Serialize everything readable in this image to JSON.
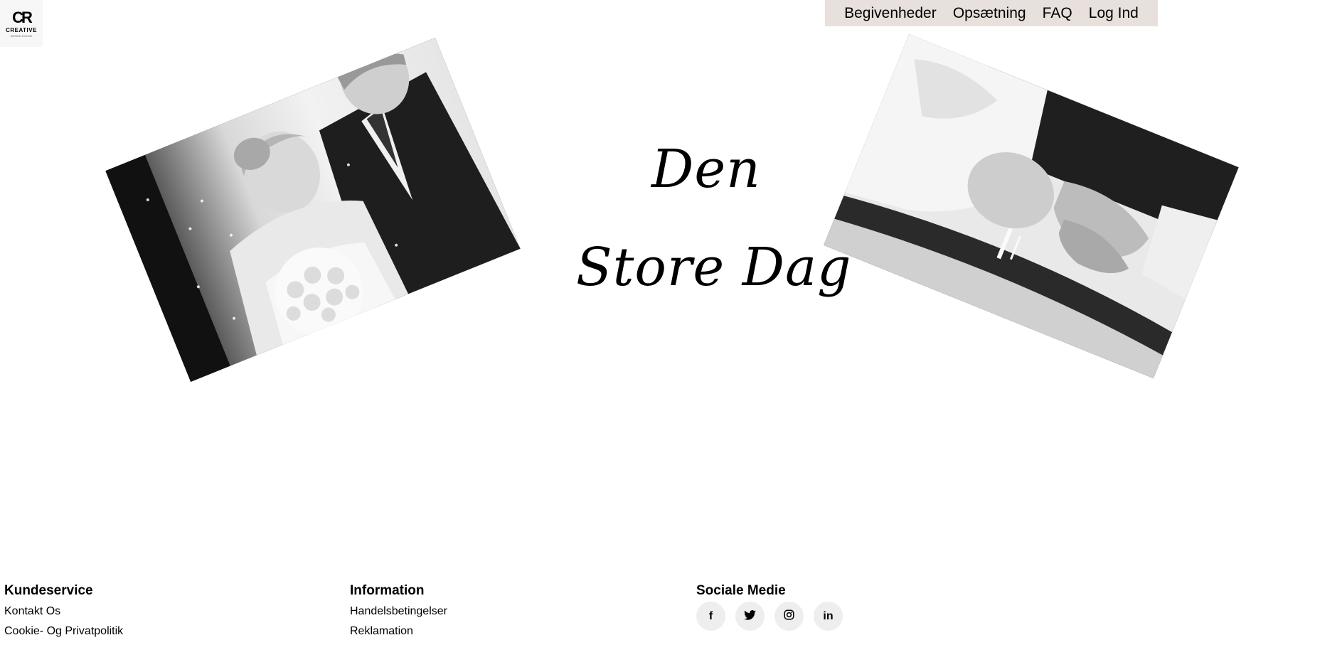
{
  "logo": {
    "mark": "CR",
    "brand": "CREATIVE",
    "tagline": "DESIGN HOUSE"
  },
  "nav": {
    "items": [
      {
        "label": "Begivenheder"
      },
      {
        "label": "Opsætning"
      },
      {
        "label": "FAQ"
      },
      {
        "label": "Log Ind"
      }
    ]
  },
  "hero": {
    "line1": "Den",
    "line2": "Store Dag"
  },
  "footer": {
    "kundeservice": {
      "title": "Kundeservice",
      "links": [
        "Kontakt Os",
        "Cookie- Og Privatpolitik"
      ]
    },
    "information": {
      "title": "Information",
      "links": [
        "Handelsbetingelser",
        "Reklamation"
      ]
    },
    "social": {
      "title": "Sociale Medie",
      "icons": [
        {
          "name": "facebook-icon",
          "glyph": "f"
        },
        {
          "name": "twitter-icon",
          "glyph": "🐦"
        },
        {
          "name": "instagram-icon",
          "glyph": "◎"
        },
        {
          "name": "linkedin-icon",
          "glyph": "in"
        }
      ]
    }
  }
}
